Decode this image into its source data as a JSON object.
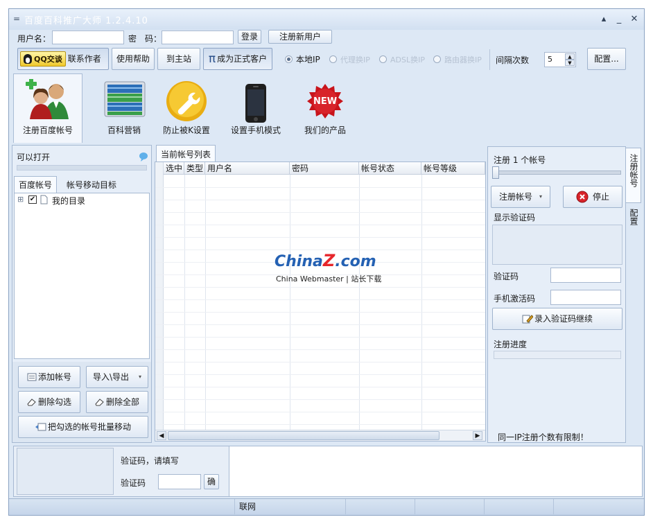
{
  "window": {
    "title": "百度百科推广大师 1.2.4.10",
    "menu_glyph": "=",
    "min": "▴",
    "restore": "_",
    "close": "✕"
  },
  "login": {
    "username_label": "用户名：",
    "password_label": "密　码：",
    "login_btn": "登录",
    "register_btn": "注册新用户"
  },
  "toolbar": {
    "qq_badge": "QQ交谈",
    "contact": "联系作者",
    "help": "使用帮助",
    "home": "到主站",
    "pi": "π",
    "become_customer": "成为正式客户",
    "radio_local": "本地IP",
    "radio_proxy": "代理换IP",
    "radio_adsl": "ADSL换IP",
    "radio_router": "路由器换IP",
    "interval_label": "间隔次数",
    "interval_value": "5",
    "config": "配置..."
  },
  "bigtools": [
    {
      "label": "注册百度帐号",
      "icon": "users-icon"
    },
    {
      "label": "百科营销",
      "icon": "books-icon"
    },
    {
      "label": "防止被K设置",
      "icon": "wrench-icon"
    },
    {
      "label": "设置手机模式",
      "icon": "phone-icon"
    },
    {
      "label": "我们的产品",
      "icon": "new-badge-icon"
    }
  ],
  "new_badge": "NEW",
  "left": {
    "can_open": "可以打开",
    "tab_accounts": "百度帐号",
    "tab_move": "帐号移动目标",
    "tree_root": "我的目录",
    "tree_expander": "⊞",
    "add_account": "添加帐号",
    "import_export": "导入\\导出",
    "delete_checked": "删除勾选",
    "delete_all": "删除全部",
    "batch_move": "把勾选的帐号批量移动"
  },
  "center": {
    "tab": "当前帐号列表",
    "columns": [
      "选中",
      "类型",
      "用户名",
      "密码",
      "帐号状态",
      "帐号等级"
    ],
    "watermark_brand_china": "China",
    "watermark_brand_z": "Z",
    "watermark_brand_com": ".com",
    "watermark_sub": "China Webmaster | 站长下载"
  },
  "right": {
    "register_count": "注册 1 个帐号",
    "register_btn": "注册帐号",
    "stop_btn": "停止",
    "show_captcha": "显示验证码",
    "captcha_label": "验证码",
    "phone_code_label": "手机激活码",
    "submit_captcha": "录入验证码继续",
    "progress_label": "注册进度",
    "limit_note": "同一IP注册个数有限制！",
    "side_tab1": "注册帐号",
    "side_tab2": "配置"
  },
  "bottom": {
    "prompt": "验证码，请填写",
    "captcha_label": "验证码",
    "confirm": "确"
  },
  "statusbar": {
    "network": "联网"
  },
  "colors": {
    "accent": "#5b8fd6",
    "frame": "#dde8f5",
    "stop_red": "#d8232a",
    "new_red": "#c8141b"
  }
}
